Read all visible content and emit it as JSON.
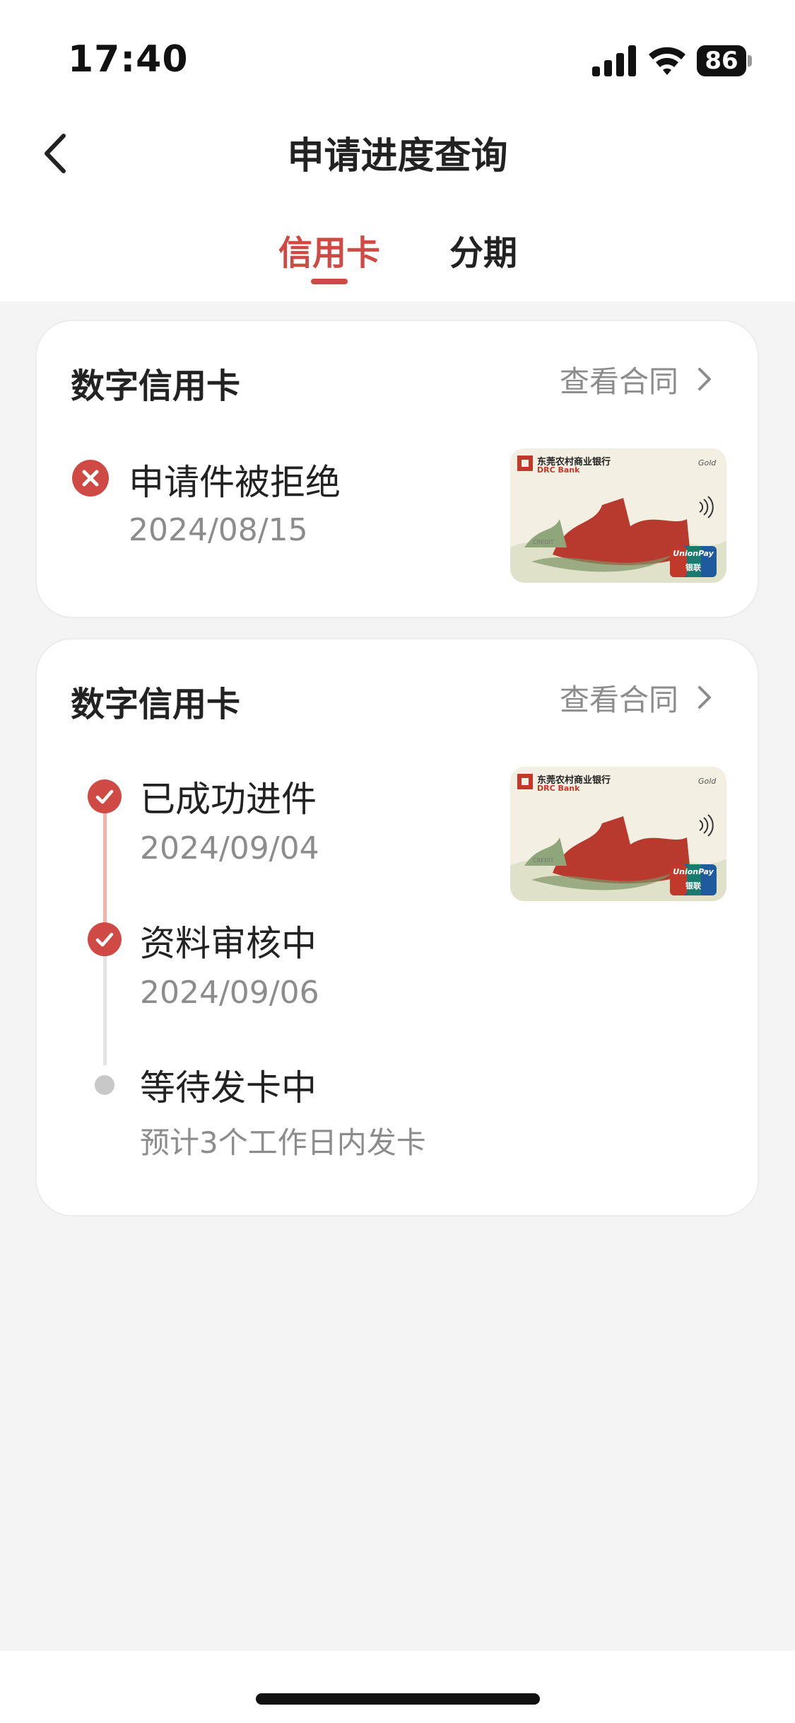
{
  "status_bar": {
    "time": "17:40",
    "battery": "86"
  },
  "nav": {
    "title": "申请进度查询"
  },
  "tabs": [
    {
      "label": "信用卡",
      "active": true
    },
    {
      "label": "分期",
      "active": false
    }
  ],
  "colors": {
    "accent": "#d04a45",
    "page_background": "#f4f4f5",
    "secondary_text": "#8c8c8c",
    "pending": "#c8c8c8"
  },
  "applications": [
    {
      "title": "数字信用卡",
      "contract_label": "查看合同",
      "status": {
        "label": "申请件被拒绝",
        "date": "2024/08/15",
        "icon": "close-circle-icon"
      },
      "card_image": {
        "bank_name_cn": "东莞农村商业银行",
        "bank_name_en": "DRC Bank",
        "grade": "Gold",
        "network": "UnionPay",
        "network_cn": "银联",
        "type": "CREDIT"
      }
    },
    {
      "title": "数字信用卡",
      "contract_label": "查看合同",
      "steps": [
        {
          "label": "已成功进件",
          "date": "2024/09/04",
          "state": "done"
        },
        {
          "label": "资料审核中",
          "date": "2024/09/06",
          "state": "done"
        },
        {
          "label": "等待发卡中",
          "date": "预计3个工作日内发卡",
          "state": "pending"
        }
      ],
      "card_image": {
        "bank_name_cn": "东莞农村商业银行",
        "bank_name_en": "DRC Bank",
        "grade": "Gold",
        "network": "UnionPay",
        "network_cn": "银联",
        "type": "CREDIT"
      }
    }
  ]
}
